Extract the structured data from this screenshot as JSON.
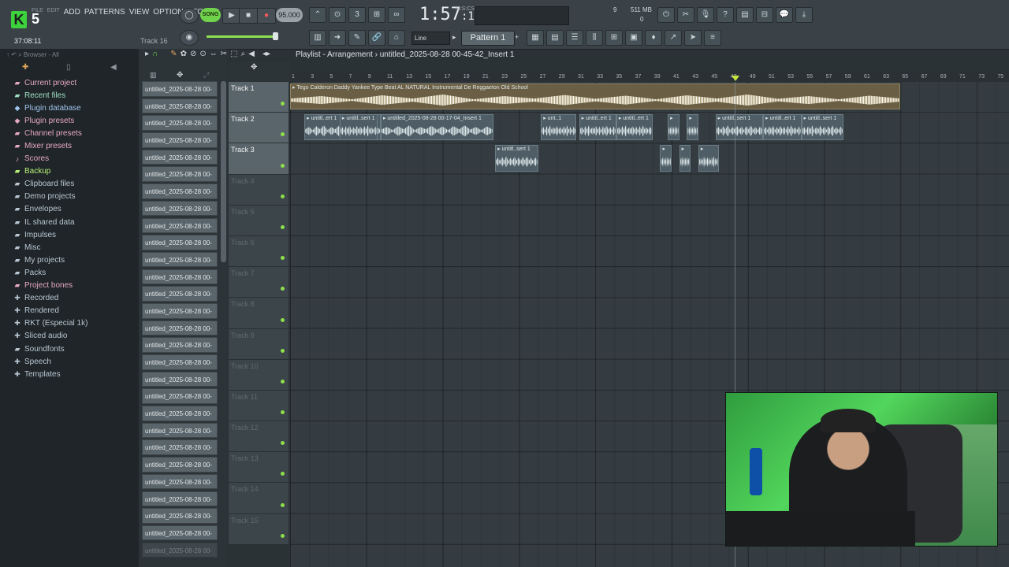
{
  "topbar": {
    "logo_letter": "K",
    "logo_number": "5",
    "menu": [
      "FILE",
      "EDIT",
      "ADD",
      "PATTERNS",
      "VIEW",
      "OPTIONS",
      "TOOLS",
      "HELP"
    ],
    "elapsed": "37:08:11",
    "hint_track": "Track 16",
    "song_label": "SONG",
    "tempo": "95.000",
    "time": "1:57",
    "time_frac": "16",
    "time_unit": "M:S:CS",
    "cpu": "9",
    "memory": "511 MB",
    "polyphony": "0",
    "snap": "Line",
    "pattern": "Pattern 1"
  },
  "browser": {
    "header": "Browser - All",
    "items": [
      {
        "label": "Current project",
        "color": "#e7a9c2",
        "icon": "folder-icon"
      },
      {
        "label": "Recent files",
        "color": "#9de0c2",
        "icon": "folder-icon"
      },
      {
        "label": "Plugin database",
        "color": "#9fc4ec",
        "icon": "plug-icon"
      },
      {
        "label": "Plugin presets",
        "color": "#e7a9c2",
        "icon": "plug-icon"
      },
      {
        "label": "Channel presets",
        "color": "#e7a9c2",
        "icon": "folder-icon"
      },
      {
        "label": "Mixer presets",
        "color": "#e7a9c2",
        "icon": "folder-icon"
      },
      {
        "label": "Scores",
        "color": "#e7a9c2",
        "icon": "note-icon"
      },
      {
        "label": "Backup",
        "color": "#b8f07a",
        "icon": "folder-icon"
      },
      {
        "label": "Clipboard files",
        "color": "#b9c6d2",
        "icon": "folder-icon"
      },
      {
        "label": "Demo projects",
        "color": "#b9c6d2",
        "icon": "folder-icon"
      },
      {
        "label": "Envelopes",
        "color": "#b9c6d2",
        "icon": "folder-icon"
      },
      {
        "label": "IL shared data",
        "color": "#b9c6d2",
        "icon": "folder-icon"
      },
      {
        "label": "Impulses",
        "color": "#b9c6d2",
        "icon": "folder-icon"
      },
      {
        "label": "Misc",
        "color": "#b9c6d2",
        "icon": "folder-icon"
      },
      {
        "label": "My projects",
        "color": "#b9c6d2",
        "icon": "folder-icon"
      },
      {
        "label": "Packs",
        "color": "#b9c6d2",
        "icon": "folder-icon"
      },
      {
        "label": "Project bones",
        "color": "#e7a9c2",
        "icon": "folder-icon"
      },
      {
        "label": "Recorded",
        "color": "#b9c6d2",
        "icon": "plus-icon"
      },
      {
        "label": "Rendered",
        "color": "#b9c6d2",
        "icon": "plus-icon"
      },
      {
        "label": "RKT (Especial 1k)",
        "color": "#b9c6d2",
        "icon": "plus-icon"
      },
      {
        "label": "Sliced audio",
        "color": "#b9c6d2",
        "icon": "plus-icon"
      },
      {
        "label": "Soundfonts",
        "color": "#b9c6d2",
        "icon": "folder-icon"
      },
      {
        "label": "Speech",
        "color": "#b9c6d2",
        "icon": "plus-icon"
      },
      {
        "label": "Templates",
        "color": "#b9c6d2",
        "icon": "plus-icon"
      }
    ]
  },
  "cliplist": {
    "item_label": "untitled_2025-08-28 00-",
    "count": 28
  },
  "playlist": {
    "title": "Playlist - Arrangement",
    "path": "untitled_2025-08-28 00-45-42_Insert 1",
    "ruler": [
      "1",
      "3",
      "5",
      "7",
      "9",
      "11",
      "13",
      "15",
      "17",
      "19",
      "21",
      "23",
      "25",
      "27",
      "29",
      "31",
      "33",
      "35",
      "37",
      "39",
      "41",
      "43",
      "45",
      "47",
      "49",
      "51",
      "53",
      "55",
      "57",
      "59",
      "61",
      "63",
      "65",
      "67",
      "69",
      "71",
      "73",
      "75"
    ],
    "tracks": [
      {
        "name": "Track 1",
        "active": true
      },
      {
        "name": "Track 2",
        "active": true
      },
      {
        "name": "Track 3",
        "active": true
      },
      {
        "name": "Track 4",
        "active": false
      },
      {
        "name": "Track 5",
        "active": false
      },
      {
        "name": "Track 6",
        "active": false
      },
      {
        "name": "Track 7",
        "active": false
      },
      {
        "name": "Track 8",
        "active": false
      },
      {
        "name": "Track 9",
        "active": false
      },
      {
        "name": "Track 10",
        "active": false
      },
      {
        "name": "Track 11",
        "active": false
      },
      {
        "name": "Track 12",
        "active": false
      },
      {
        "name": "Track 13",
        "active": false
      },
      {
        "name": "Track 14",
        "active": false
      },
      {
        "name": "Track 15",
        "active": false
      }
    ],
    "clips": [
      {
        "track": 0,
        "start": 1,
        "end": 65,
        "label": "Tego Calderon  Daddy Yankee Type Beat AL NATURAL Instrumental De Reggaeton Old School",
        "big": true
      },
      {
        "track": 1,
        "start": 2.5,
        "end": 10.5,
        "label": "untitl..ert 1"
      },
      {
        "track": 1,
        "start": 6.2,
        "end": 10.2,
        "label": "untitl..sert 1"
      },
      {
        "track": 1,
        "start": 10.5,
        "end": 22.3,
        "label": "untitled_2025-08-28 00-17-04_Insert 1"
      },
      {
        "track": 1,
        "start": 27.3,
        "end": 31,
        "label": "unt..1"
      },
      {
        "track": 1,
        "start": 31.3,
        "end": 35.2,
        "label": "untitl..ert 1"
      },
      {
        "track": 1,
        "start": 35.2,
        "end": 39,
        "label": "untitl..ert 1"
      },
      {
        "track": 1,
        "start": 40.6,
        "end": 41.8,
        "label": ""
      },
      {
        "track": 1,
        "start": 42.6,
        "end": 43.8,
        "label": ""
      },
      {
        "track": 1,
        "start": 45.6,
        "end": 50.6,
        "label": "untitl..sert 1"
      },
      {
        "track": 1,
        "start": 50.6,
        "end": 54.6,
        "label": "untitl..ert 1"
      },
      {
        "track": 1,
        "start": 54.6,
        "end": 59,
        "label": "untitl..sert 1"
      },
      {
        "track": 2,
        "start": 22.5,
        "end": 27,
        "label": "untitl..sert 1"
      },
      {
        "track": 2,
        "start": 39.8,
        "end": 41,
        "label": ""
      },
      {
        "track": 2,
        "start": 41.8,
        "end": 43,
        "label": ""
      },
      {
        "track": 2,
        "start": 43.8,
        "end": 46,
        "label": ""
      }
    ],
    "playhead_bar": 47
  }
}
